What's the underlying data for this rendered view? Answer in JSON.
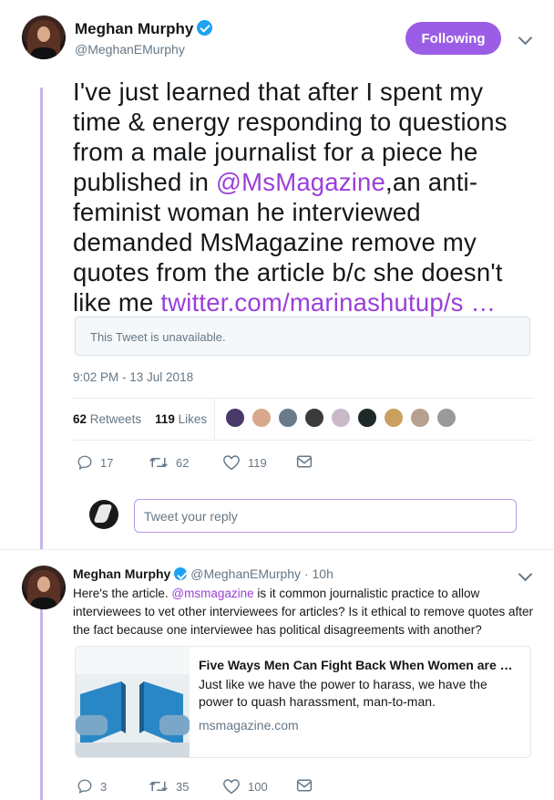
{
  "main_tweet": {
    "author_name": "Meghan Murphy",
    "author_handle": "@MeghanEMurphy",
    "follow_label": "Following",
    "text_part1": "I've just learned that after I spent my time & energy responding to questions from a male journalist for a piece he published in ",
    "mention": "@MsMagazine",
    "text_part2": ",an anti-feminist woman he interviewed demanded MsMagazine remove my quotes from the article b/c she doesn't like me ",
    "link": "twitter.com/marinashutup/s …",
    "quoted_unavailable": "This Tweet is unavailable.",
    "timestamp": "9:02 PM - 13 Jul 2018",
    "retweets_count": "62",
    "retweets_label": "Retweets",
    "likes_count": "119",
    "likes_label": "Likes",
    "actions": {
      "replies": "17",
      "retweets": "62",
      "likes": "119"
    },
    "liker_avatar_colors": [
      "#4a3a6a",
      "#d9a88a",
      "#6a7a8a",
      "#3a3a3a",
      "#c8b8c8",
      "#1c2a2a",
      "#c9a060",
      "#b8a090",
      "#9a9a9a"
    ]
  },
  "reply_box": {
    "placeholder": "Tweet your reply"
  },
  "reply_tweet": {
    "author_name": "Meghan Murphy",
    "author_handle": "@MeghanEMurphy",
    "time_ago": "· 10h",
    "text_part1": "Here's the article. ",
    "mention": "@msmagazine",
    "text_part2": " is it common journalistic practice to allow interviewees to vet other interviewees for articles? Is it ethical to remove quotes after the fact because one interviewee has political disagreements with another?",
    "card": {
      "title": "Five Ways Men Can Fight Back When Women are Harassed",
      "description": "Just like we have the power to harass, we have the power to quash harassment, man-to-man.",
      "domain": "msmagazine.com"
    },
    "actions": {
      "replies": "3",
      "retweets": "35",
      "likes": "100"
    }
  },
  "colors": {
    "accent": "#9b5de5",
    "link": "#9b3fd8",
    "thread": "#c9b4e8",
    "muted": "#657786"
  }
}
